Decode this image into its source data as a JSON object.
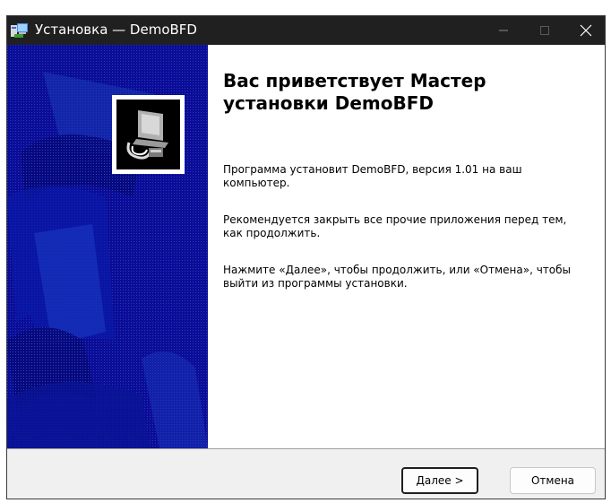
{
  "window": {
    "title": "Установка — DemoBFD",
    "icons": {
      "app": "installer-icon",
      "minimize": "minimize-icon",
      "maximize": "maximize-icon",
      "close": "close-icon"
    },
    "titlebar_color": "#202020",
    "banner_color": "#0a0a90"
  },
  "wizard": {
    "heading": "Вас приветствует Мастер установки DemoBFD",
    "paragraphs": [
      "Программа установит DemoBFD, версия 1.01 на ваш компьютер.",
      "Рекомендуется закрыть все прочие приложения перед тем, как продолжить.",
      "Нажмите «Далее», чтобы продолжить, или «Отмена», чтобы выйти из программы установки."
    ],
    "logo_icon": "setup-computer-icon"
  },
  "buttons": {
    "next_mnemonic": "Д",
    "next_rest": "алее >",
    "cancel": "Отмена"
  }
}
